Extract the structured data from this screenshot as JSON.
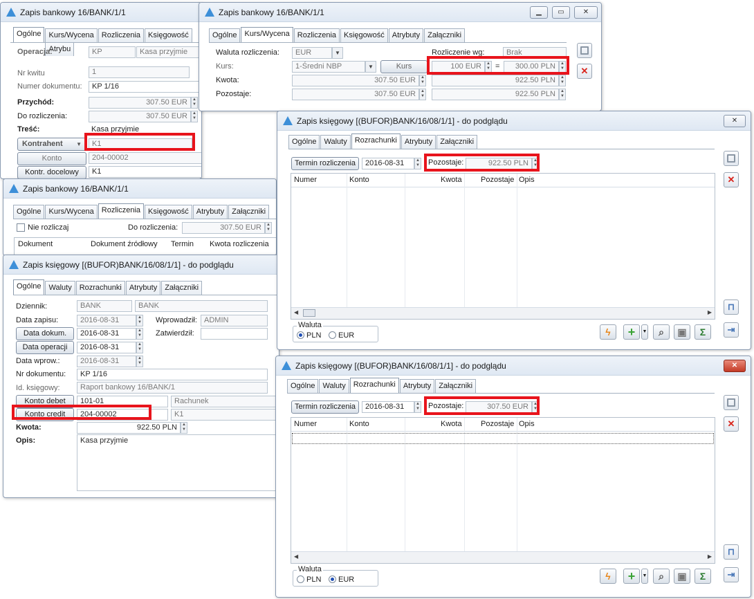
{
  "colors": {
    "highlight": "#e8141c",
    "accent": "#3d8fd8",
    "title_bar": "#dfe8f3",
    "delete_red": "#d9251c",
    "plus_green": "#3aa335",
    "bolt_orange": "#e8861a"
  },
  "icons": {
    "app": "triangle-logo-icon",
    "minimize": "minimize-icon",
    "maximize": "maximize-icon",
    "close": "close-icon",
    "save": "floppy-disk-icon",
    "delete": "red-x-icon",
    "lock": "padlock-icon",
    "pin": "pin-icon",
    "lightning": "lightning-icon",
    "add": "plus-icon",
    "search": "magnifier-icon",
    "trash": "trash-icon",
    "sum": "sigma-icon"
  },
  "w1": {
    "title": "Zapis bankowy 16/BANK/1/1",
    "tabs": [
      "Ogólne",
      "Kurs/Wycena",
      "Rozliczenia",
      "Księgowość",
      "Atrybu"
    ],
    "operacja_label": "Operacja:",
    "operacja_code": "KP",
    "operacja_name": "Kasa przyjmie",
    "nr_kwitu_label": "Nr kwitu",
    "nr_kwitu_value": "1",
    "numer_dok_label": "Numer dokumentu:",
    "numer_dok_value": "KP 1/16",
    "przychod_label": "Przychód:",
    "przychod_value": "307.50 EUR",
    "do_rozl_label": "Do rozliczenia:",
    "do_rozl_value": "307.50 EUR",
    "tresc_label": "Treść:",
    "tresc_value": "Kasa przyjmie",
    "kontrahent_button": "Kontrahent",
    "kontrahent_value": "K1",
    "konto_button": "Konto",
    "konto_value": "204-00002",
    "kontr_docelowy_button": "Kontr. docelowy",
    "kontr_docelowy_value": "K1"
  },
  "w2": {
    "title": "Zapis bankowy 16/BANK/1/1",
    "tabs": [
      "Ogólne",
      "Kurs/Wycena",
      "Rozliczenia",
      "Księgowość",
      "Atrybuty",
      "Załączniki"
    ],
    "waluta_label": "Waluta rozliczenia:",
    "waluta_value": "EUR",
    "rozl_wg_label": "Rozliczenie wg:",
    "rozl_wg_value": "Brak",
    "kurs_label": "Kurs:",
    "kurs_value": "1-Średni NBP",
    "kurs_button": "Kurs",
    "kurs_from": "100 EUR",
    "kurs_eq": "=",
    "kurs_to": "300.00 PLN",
    "kwota_label": "Kwota:",
    "kwota_eur": "307.50 EUR",
    "kwota_pln": "922.50 PLN",
    "pozostaje_label": "Pozostaje:",
    "pozostaje_eur": "307.50 EUR",
    "pozostaje_pln": "922.50 PLN"
  },
  "w3": {
    "title": "Zapis bankowy 16/BANK/1/1",
    "tabs": [
      "Ogólne",
      "Kurs/Wycena",
      "Rozliczenia",
      "Księgowość",
      "Atrybuty",
      "Załączniki"
    ],
    "nie_rozliczaj_label": "Nie rozliczaj",
    "do_rozl_label": "Do rozliczenia:",
    "do_rozl_value": "307.50 EUR",
    "columns": [
      "Dokument",
      "Dokument źródłowy",
      "Termin",
      "Kwota rozliczenia"
    ]
  },
  "w4": {
    "title": "Zapis księgowy [(BUFOR)BANK/16/08/1/1] - do podglądu",
    "tabs": [
      "Ogólne",
      "Waluty",
      "Rozrachunki",
      "Atrybuty",
      "Załączniki"
    ],
    "dziennik_label": "Dziennik:",
    "dziennik_code": "BANK",
    "dziennik_name": "BANK",
    "data_zapisu_label": "Data zapisu:",
    "data_zapisu_value": "2016-08-31",
    "wprowadzil_label": "Wprowadził:",
    "wprowadzil_value": "ADMIN",
    "data_dokum_button": "Data dokum.",
    "data_dokum_value": "2016-08-31",
    "zatwierdzil_label": "Zatwierdził:",
    "zatwierdzil_value": "",
    "data_operacji_button": "Data operacji",
    "data_operacji_value": "2016-08-31",
    "data_wprow_label": "Data wprow.:",
    "data_wprow_value": "2016-08-31",
    "nr_dok_label": "Nr dokumentu:",
    "nr_dok_value": "KP 1/16",
    "id_ksieg_label": "Id. księgowy:",
    "id_ksieg_value": "Raport bankowy 16/BANK/1",
    "konto_debet_button": "Konto debet",
    "konto_debet_value": "101-01",
    "konto_debet_name": "Rachunek",
    "konto_credit_button": "Konto credit",
    "konto_credit_value": "204-00002",
    "konto_credit_name": "K1",
    "kwota_label": "Kwota:",
    "kwota_value": "922.50 PLN",
    "opis_label": "Opis:",
    "opis_value": "Kasa przyjmie"
  },
  "w5": {
    "title": "Zapis księgowy [(BUFOR)BANK/16/08/1/1] - do podglądu",
    "tabs": [
      "Ogólne",
      "Waluty",
      "Rozrachunki",
      "Atrybuty",
      "Załączniki"
    ],
    "termin_button": "Termin rozliczenia",
    "termin_value": "2016-08-31",
    "pozostaje_label": "Pozostaje:",
    "pozostaje_value": "922.50 PLN",
    "columns": [
      "Numer",
      "Konto",
      "Kwota",
      "Pozostaje",
      "Opis"
    ],
    "waluta_label": "Waluta",
    "radio_pln": "PLN",
    "radio_eur": "EUR",
    "selected": "PLN"
  },
  "w6": {
    "title": "Zapis księgowy [(BUFOR)BANK/16/08/1/1] - do podglądu",
    "tabs": [
      "Ogólne",
      "Waluty",
      "Rozrachunki",
      "Atrybuty",
      "Załączniki"
    ],
    "termin_button": "Termin rozliczenia",
    "termin_value": "2016-08-31",
    "pozostaje_label": "Pozostaje:",
    "pozostaje_value": "307.50 EUR",
    "columns": [
      "Numer",
      "Konto",
      "Kwota",
      "Pozostaje",
      "Opis"
    ],
    "waluta_label": "Waluta",
    "radio_pln": "PLN",
    "radio_eur": "EUR",
    "selected": "EUR"
  }
}
